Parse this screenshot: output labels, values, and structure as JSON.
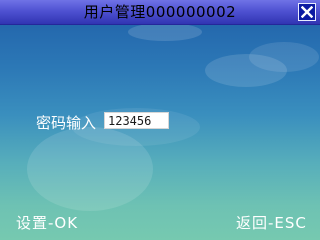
{
  "window": {
    "title": "用户管理000000002",
    "close_icon": "close-icon"
  },
  "form": {
    "password_label": "密码输入",
    "password_value": "123456"
  },
  "softkeys": {
    "left_label": "设置-OK",
    "right_label": "返回-ESC"
  },
  "colors": {
    "titlebar": "#4f52d2",
    "close_button": "#0c1aa2",
    "background_top": "#1f5fa8",
    "background_bottom": "#76c9b0",
    "text": "#ffffff"
  }
}
